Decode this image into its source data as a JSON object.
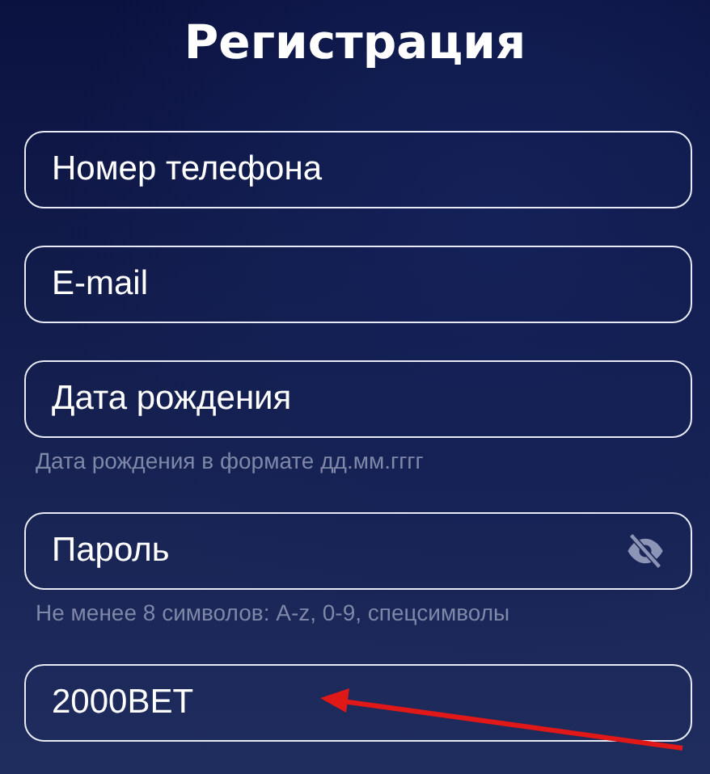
{
  "title": "Регистрация",
  "fields": [
    {
      "kind": "text",
      "placeholder": "Номер телефона"
    },
    {
      "kind": "text",
      "placeholder": "E-mail"
    },
    {
      "kind": "text",
      "placeholder": "Дата рождения",
      "hint": "Дата рождения в формате дд.мм.гггг"
    },
    {
      "kind": "password",
      "placeholder": "Пароль",
      "hint": "Не менее 8 символов: A-z, 0-9, спецсимволы"
    },
    {
      "kind": "text",
      "value": "2000BET"
    }
  ]
}
